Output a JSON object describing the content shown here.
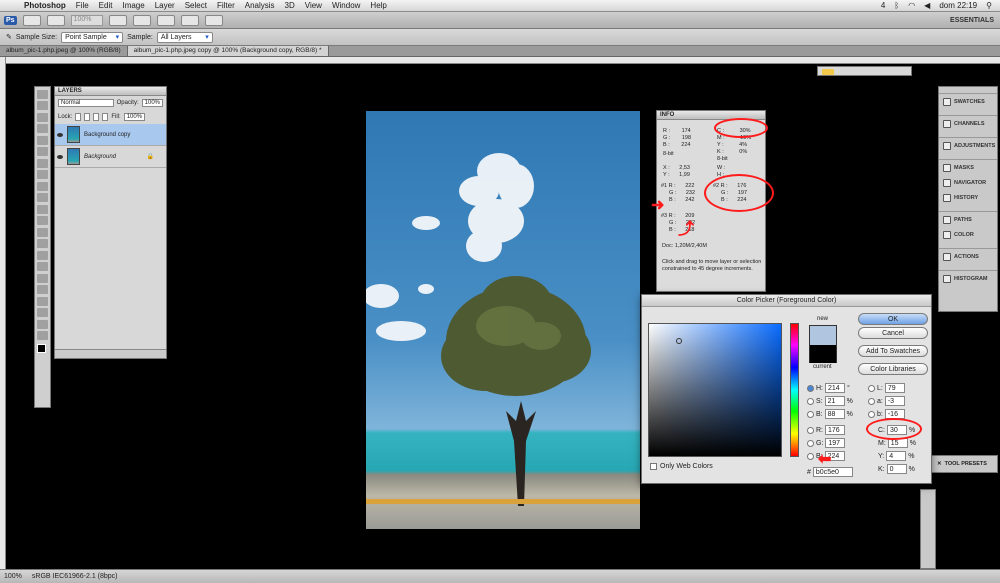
{
  "menubar": {
    "app_name": "Photoshop",
    "menus": [
      "File",
      "Edit",
      "Image",
      "Layer",
      "Select",
      "Filter",
      "Analysis",
      "3D",
      "View",
      "Window",
      "Help"
    ],
    "right": [
      "4",
      "dom 22:19"
    ]
  },
  "appbar": {
    "ps_label": "Ps",
    "zoom": "100%",
    "workspace": "ESSENTIALS"
  },
  "options": {
    "sample_size_label": "Sample Size:",
    "sample_size_value": "Point Sample",
    "sample_label": "Sample:",
    "sample_value": "All Layers"
  },
  "tabs": [
    "album_pic-1.php.jpeg @ 100% (RGB/8)",
    "album_pic-1.php.jpeg copy @ 100% (Background copy, RGB/8) *"
  ],
  "layers": {
    "title": "LAYERS",
    "blend_mode": "Normal",
    "opacity_label": "Opacity:",
    "opacity_value": "100%",
    "lock_label": "Lock:",
    "fill_label": "Fill:",
    "fill_value": "100%",
    "items": [
      {
        "name": "Background copy"
      },
      {
        "name": "Background"
      }
    ]
  },
  "info": {
    "title": "INFO",
    "rgb1": [
      "R :",
      "174",
      "G :",
      "198",
      "B :",
      "224"
    ],
    "cmyk1": [
      "C :",
      "30%",
      "M :",
      "15%",
      "Y :",
      "4%",
      "K :",
      "0%"
    ],
    "bit1": "8-bit",
    "bit2": "8-bit",
    "xy": [
      "X :",
      "2,53",
      "Y :",
      "1,99"
    ],
    "wh": [
      "W :",
      "H :"
    ],
    "s1": [
      "#1 R :",
      "222",
      "G :",
      "232",
      "B :",
      "242"
    ],
    "s2": [
      "#2 R :",
      "176",
      "G :",
      "197",
      "B :",
      "224"
    ],
    "s3": [
      "#3 R :",
      "209",
      "G :",
      "222",
      "B :",
      "218"
    ],
    "doc": "Doc: 1,20M/2,40M",
    "hint": "Click and drag to move layer or selection constrained to 45 degree increments."
  },
  "dock": {
    "items": [
      "SWATCHES",
      "CHANNELS",
      "ADJUSTMENTS",
      "MASKS",
      "NAVIGATOR",
      "HISTORY",
      "PATHS",
      "COLOR",
      "ACTIONS",
      "HISTOGRAM"
    ],
    "tool_presets": "TOOL PRESETS"
  },
  "picker": {
    "title": "Color Picker (Foreground Color)",
    "new_label": "new",
    "current_label": "current",
    "ok": "OK",
    "cancel": "Cancel",
    "add_swatches": "Add To Swatches",
    "color_libraries": "Color Libraries",
    "only_web": "Only Web Colors",
    "H": "214",
    "S": "21",
    "B": "88",
    "R": "176",
    "G": "197",
    "Bv": "224",
    "L": "79",
    "a": "-3",
    "b": "-16",
    "C": "30",
    "M": "15",
    "Y": "4",
    "K": "0",
    "hex": "b0c5e0",
    "deg": "°",
    "pct": "%",
    "hash": "#",
    "new_color": "#b0c5e0",
    "current_color": "#000000"
  },
  "status": {
    "zoom": "100%",
    "profile": "sRGB IEC61966-2.1 (8bpc)"
  }
}
